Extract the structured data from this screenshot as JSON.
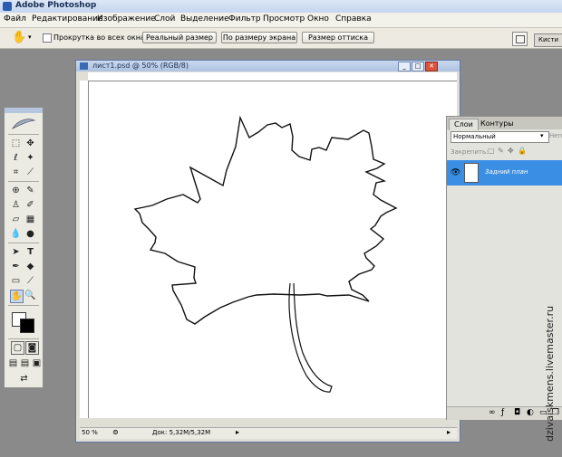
{
  "app": {
    "title": "Adobe Photoshop"
  },
  "menu": [
    "Файл",
    "Редактирование",
    "Изображение",
    "Слой",
    "Выделение",
    "Фильтр",
    "Просмотр",
    "Окно",
    "Справка"
  ],
  "options": {
    "scroll_all_label": "Прокрутка во всех окнах",
    "actual_pixels": "Реальный размер",
    "fit_screen": "По размеру экрана",
    "print_size": "Размер оттиска"
  },
  "workspace": {
    "brushes_tab": "Кисти"
  },
  "document": {
    "title": "лист1.psd @ 50% (RGB/8)",
    "zoom": "50 %",
    "doc_info": "Док: 5,32M/5,32M"
  },
  "layers_panel": {
    "tabs": [
      "Слои",
      "Контуры"
    ],
    "blend_mode": "Нормальный",
    "opacity_label": "Непр",
    "lock_label": "Закрепить:",
    "layer_name": "Задний план"
  },
  "watermark": "dzivaiskmens.livemaster.ru"
}
